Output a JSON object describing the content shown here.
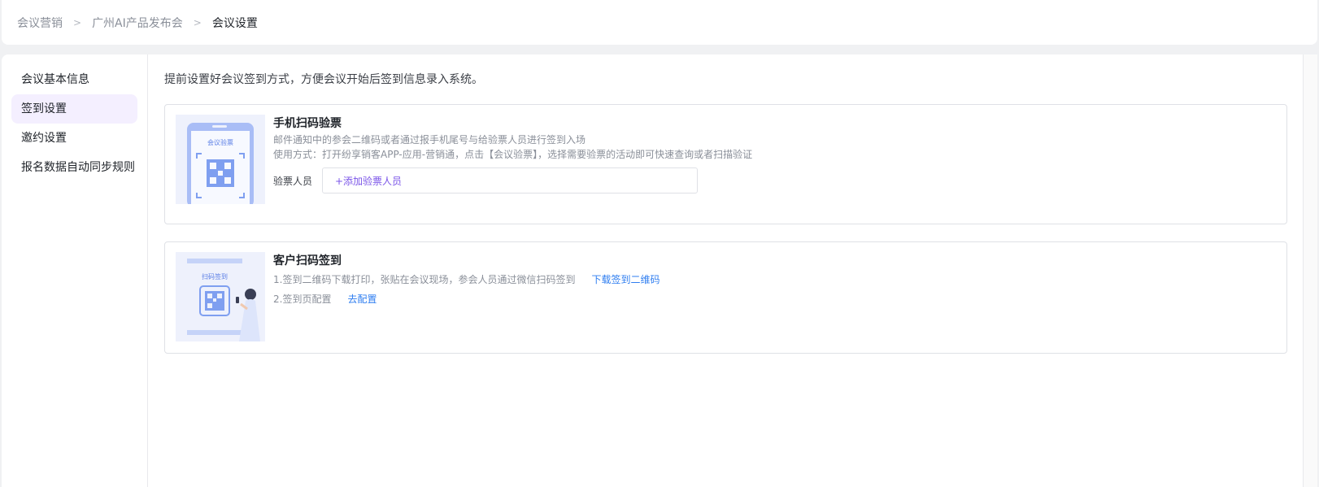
{
  "breadcrumb": {
    "items": [
      "会议营销",
      "广州AI产品发布会",
      "会议设置"
    ],
    "separator": ">"
  },
  "sidebar": {
    "items": [
      {
        "label": "会议基本信息",
        "active": false
      },
      {
        "label": "签到设置",
        "active": true
      },
      {
        "label": "邀约设置",
        "active": false
      },
      {
        "label": "报名数据自动同步规则",
        "active": false
      }
    ]
  },
  "main": {
    "intro": "提前设置好会议签到方式，方便会议开始后签到信息录入系统。",
    "mobile_card": {
      "illustration_label": "会议验票",
      "title": "手机扫码验票",
      "desc1": "邮件通知中的参会二维码或者通过报手机尾号与给验票人员进行签到入场",
      "desc2": "使用方式：打开纷享销客APP-应用-营销通，点击【会议验票】，选择需要验票的活动即可快速查询或者扫描验证",
      "staff_label": "验票人员",
      "add_staff": "+添加验票人员"
    },
    "customer_card": {
      "illustration_label": "扫码签到",
      "title": "客户扫码签到",
      "step1": "1.签到二维码下载打印，张贴在会议现场，参会人员通过微信扫码签到",
      "step1_link": "下载签到二维码",
      "step2": "2.签到页配置",
      "step2_link": "去配置"
    }
  },
  "colors": {
    "accent_purple": "#7b55e8",
    "link_blue": "#2f7ef0",
    "active_bg": "#f4efff",
    "illustration_blue": "#7f9ff0"
  }
}
